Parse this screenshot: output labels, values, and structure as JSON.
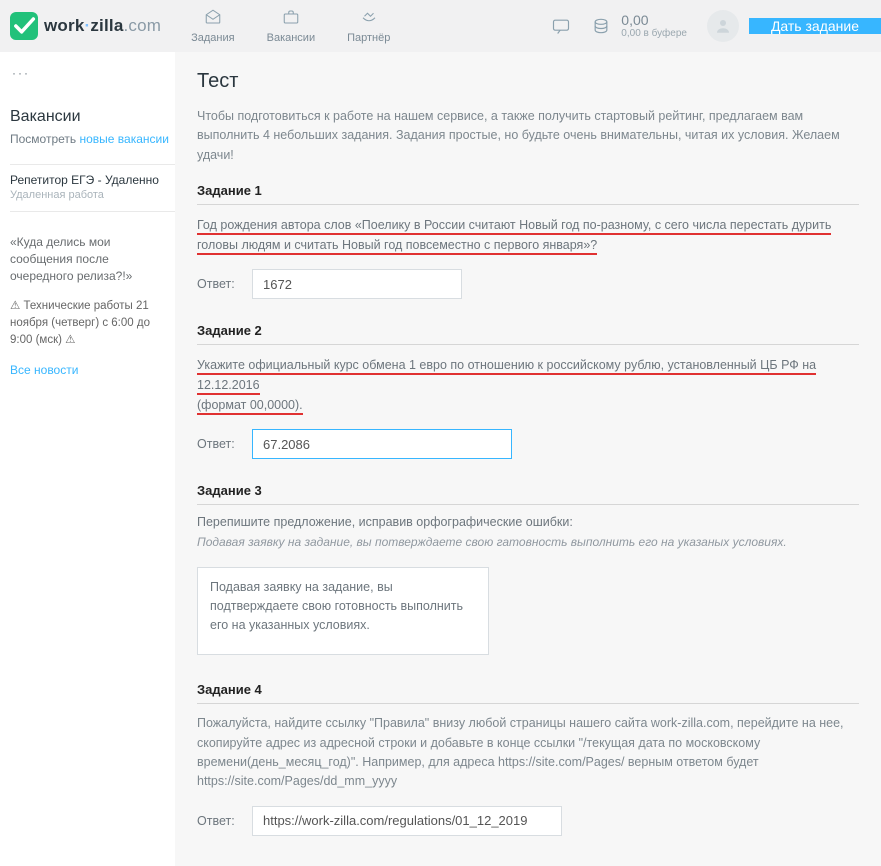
{
  "header": {
    "logo_word1": "work",
    "logo_word2": "zilla",
    "logo_dot": "·",
    "logo_com": ".com",
    "nav": {
      "tasks": "Задания",
      "vacancies": "Вакансии",
      "partner": "Партнёр"
    },
    "balance_amount": "0,00",
    "balance_sub": "0,00 в буфере",
    "cta": "Дать задание"
  },
  "sidebar": {
    "vac_heading": "Вакансии",
    "vac_look": "Посмотреть ",
    "vac_link": "новые вакансии",
    "ad_title": "Репетитор ЕГЭ - Удаленно",
    "ad_sub": "Удаленная работа",
    "promo": "«Куда делись мои сообщения после очередного релиза?!»",
    "note": "⚠ Технические работы 21 ноября (четверг) с 6:00 до 9:00 (мск) ⚠",
    "all_news": "Все новости"
  },
  "content": {
    "title": "Тест",
    "intro": "Чтобы подготовиться к работе на нашем сервисе, а также получить стартовый рейтинг, предлагаем вам выполнить 4 небольших задания. Задания простые, но будьте очень внимательны, читая их условия. Желаем удачи!",
    "answer_label": "Ответ:",
    "task1": {
      "h": "Задание 1",
      "q": "Год рождения автора слов «Поелику в России считают Новый год по-разному, с сего числа перестать дурить головы людям и считать Новый год повсеместно с первого января»?",
      "value": "1672"
    },
    "task2": {
      "h": "Задание 2",
      "q1": "Укажите официальный курс обмена 1 евро по отношению к российскому рублю, установленный ЦБ РФ на 12.12.2016",
      "q2": "(формат 00,0000).",
      "value": "67.2086"
    },
    "task3": {
      "h": "Задание 3",
      "instr": "Перепишите предложение, исправив орфографические ошибки:",
      "bad": "Подавая заявку на задание, вы потверждаете свою гатовность выполнить его на указаных условиях.",
      "value": "Подавая заявку на задание, вы подтверждаете свою готовность выполнить его на указанных условиях."
    },
    "task4": {
      "h": "Задание 4",
      "p": "Пожалуйста, найдите ссылку \"Правила\" внизу любой страницы нашего сайта work-zilla.com, перейдите на нее, скопируйте адрес из адресной строки и добавьте в конце ссылки \"/текущая дата по московскому времени(день_месяц_год)\". Например, для адреса https://site.com/Pages/ верным ответом будет https://site.com/Pages/dd_mm_yyyy",
      "value": "https://work-zilla.com/regulations/01_12_2019"
    }
  }
}
